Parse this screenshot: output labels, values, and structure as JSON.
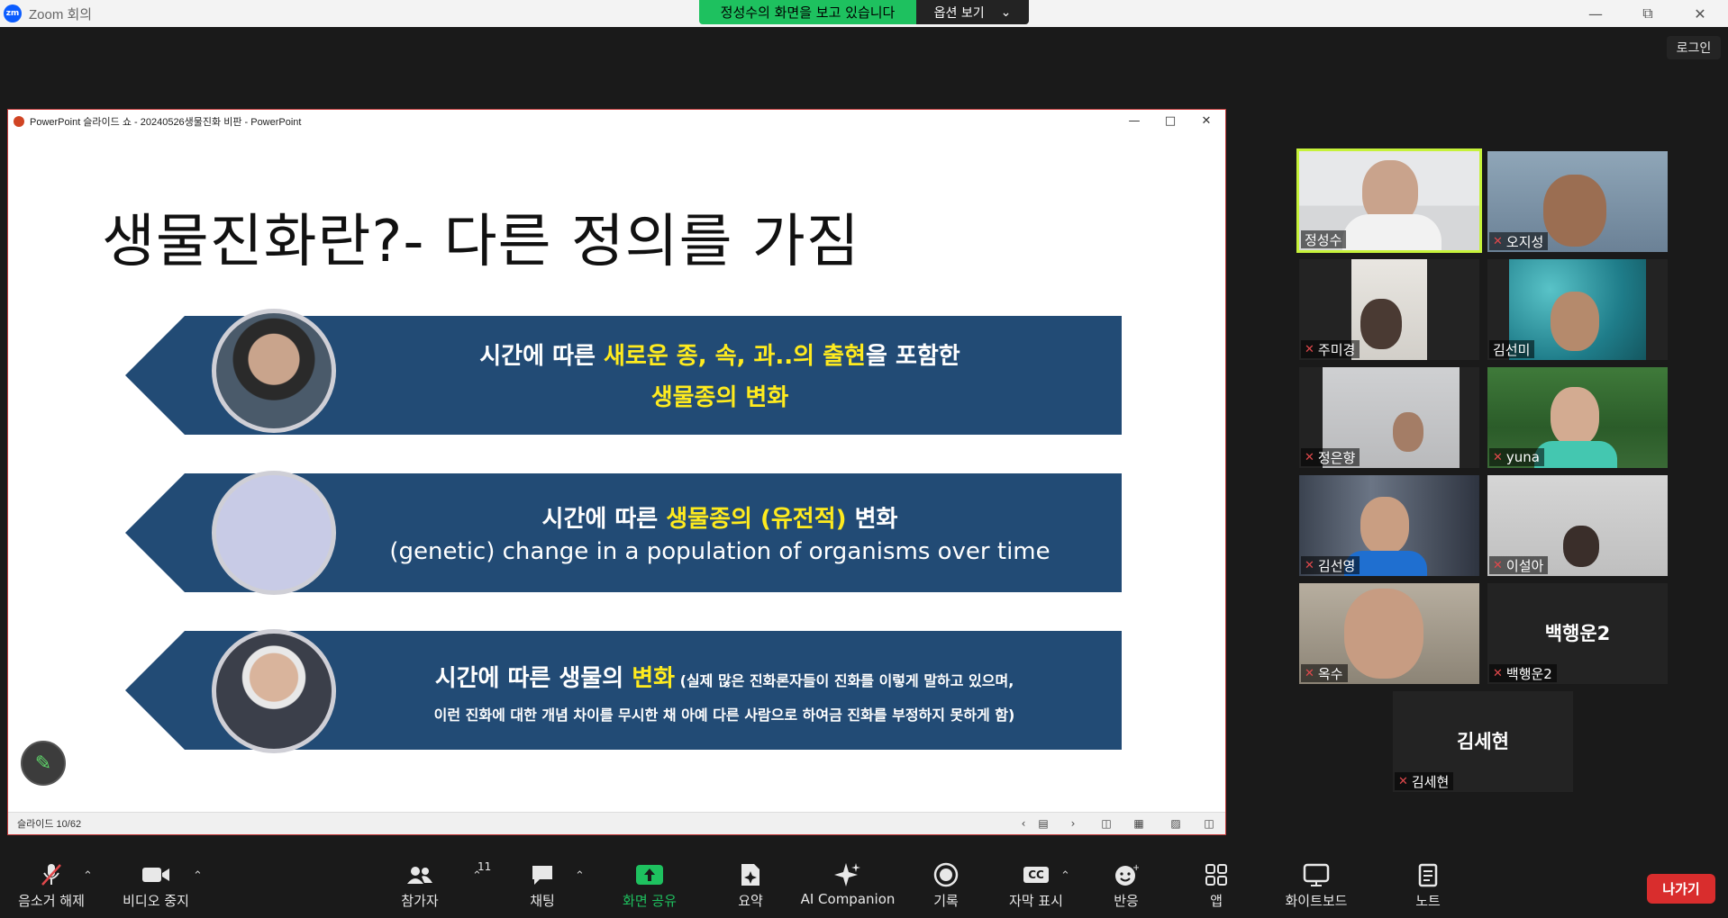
{
  "app": {
    "title": "Zoom 회의",
    "logo_text": "zm",
    "viewing_banner": "정성수의 화면을 보고 있습니다",
    "options_label": "옵션 보기",
    "login_label": "로그인"
  },
  "shared_window": {
    "title": "PowerPoint 슬라이드 쇼  -  20240526생물진화 비판  -  PowerPoint",
    "slide_status": "슬라이드 10/62"
  },
  "slide": {
    "title": "생물진화란?- 다른 정의를 가짐",
    "banner1": {
      "pre": "시간에 따른 ",
      "hl": "새로운 종, 속, 과..의 출현",
      "post": "을 포함한",
      "line2": "생물종의 변화"
    },
    "banner2": {
      "pre": "시간에 따른 ",
      "hl": "생물종의 (유전적)",
      "post": " 변화",
      "line2": "(genetic) change in a population of organisms over time"
    },
    "banner3": {
      "pre": "시간에 따른 생물의 ",
      "hl": "변화",
      "note1": " (실제 많은 진화론자들이 진화를 이렇게 말하고 있으며,",
      "line2": "이런 진화에 대한 개념 차이를  무시한 채 아예 다른 사람으로 하여금 진화를 부정하지 못하게 함)"
    }
  },
  "participants": [
    {
      "name": "정성수",
      "muted": false,
      "video": true,
      "active": true
    },
    {
      "name": "오지성",
      "muted": true,
      "video": true
    },
    {
      "name": "주미경",
      "muted": true,
      "video": true
    },
    {
      "name": "김선미",
      "muted": false,
      "video": true
    },
    {
      "name": "정은향",
      "muted": true,
      "video": true
    },
    {
      "name": "yuna",
      "muted": true,
      "video": true
    },
    {
      "name": "김선영",
      "muted": true,
      "video": true
    },
    {
      "name": "이설아",
      "muted": true,
      "video": true
    },
    {
      "name": "옥수",
      "muted": true,
      "video": true
    },
    {
      "name": "백행운2",
      "muted": true,
      "video": false,
      "display_name": "백행운2"
    },
    {
      "name": "김세현",
      "muted": true,
      "video": false,
      "display_name": "김세현"
    }
  ],
  "toolbar": {
    "mute": "음소거 해제",
    "video": "비디오 중지",
    "participants": "참가자",
    "participant_count": "11",
    "chat": "채팅",
    "share": "화면 공유",
    "summary": "요약",
    "ai": "AI Companion",
    "record": "기록",
    "captions": "자막 표시",
    "captions_icon": "CC",
    "reactions": "반응",
    "apps": "앱",
    "whiteboard": "화이트보드",
    "notes": "노트",
    "leave": "나가기"
  },
  "colors": {
    "banner_blue": "#224b75",
    "highlight_yellow": "#ffeb1e",
    "share_green": "#1ec15f",
    "leave_red": "#d92d2d",
    "active_speaker": "#c6f23a"
  }
}
